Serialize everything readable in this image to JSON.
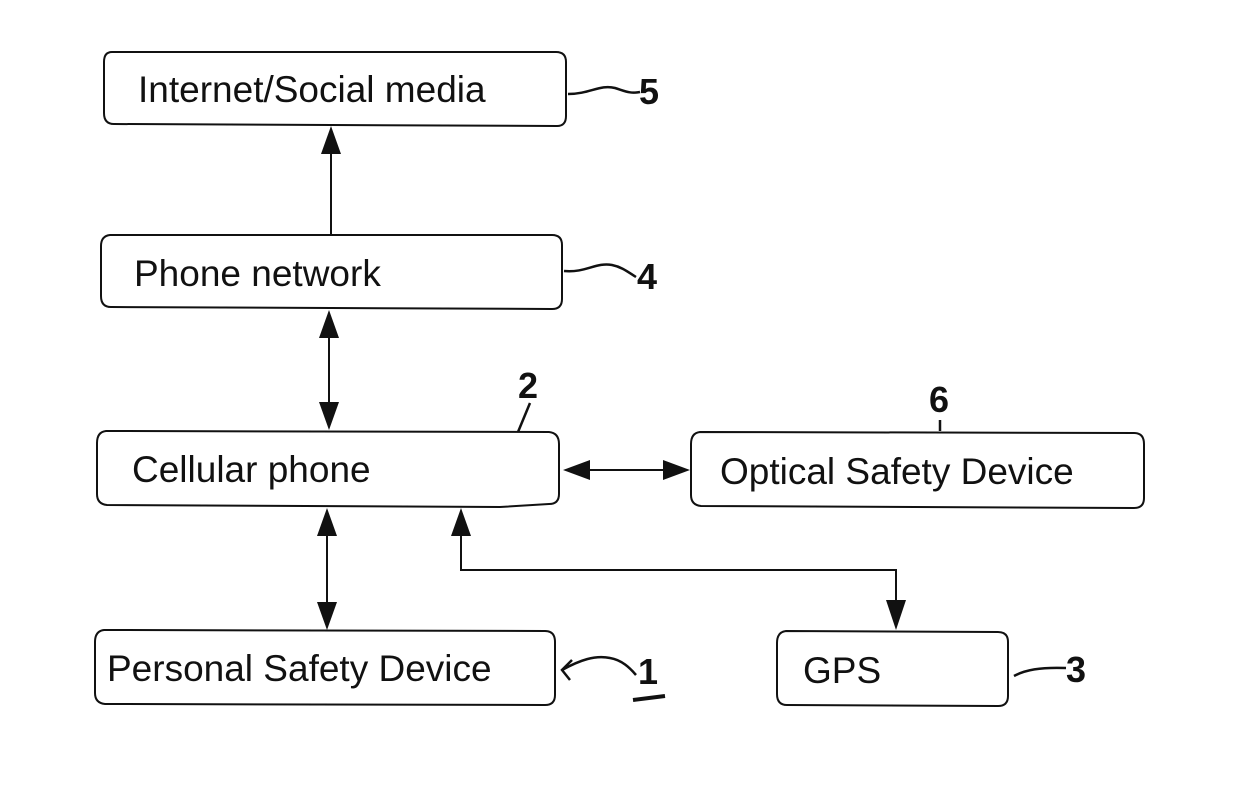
{
  "diagram": {
    "type": "block-diagram",
    "nodes": [
      {
        "id": "internet",
        "label": "Internet/Social media",
        "ref": "5"
      },
      {
        "id": "phone_network",
        "label": "Phone network",
        "ref": "4"
      },
      {
        "id": "cellular_phone",
        "label": "Cellular phone",
        "ref": "2"
      },
      {
        "id": "optical_safety_device",
        "label": "Optical Safety Device",
        "ref": "6"
      },
      {
        "id": "personal_safety_device",
        "label": "Personal Safety Device",
        "ref": "1"
      },
      {
        "id": "gps",
        "label": "GPS",
        "ref": "3"
      }
    ],
    "edges": [
      {
        "from": "phone_network",
        "to": "internet",
        "direction": "one-way"
      },
      {
        "from": "phone_network",
        "to": "cellular_phone",
        "direction": "bidirectional"
      },
      {
        "from": "cellular_phone",
        "to": "optical_safety_device",
        "direction": "bidirectional"
      },
      {
        "from": "cellular_phone",
        "to": "personal_safety_device",
        "direction": "bidirectional"
      },
      {
        "from": "gps",
        "to": "cellular_phone",
        "direction": "bidirectional"
      }
    ]
  }
}
